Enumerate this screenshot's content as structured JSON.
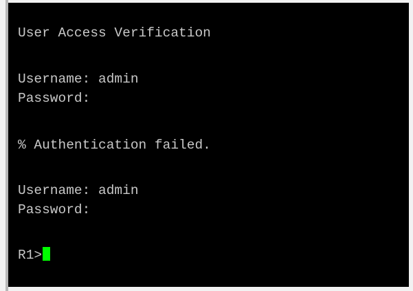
{
  "terminal": {
    "header": "User Access Verification",
    "attempts": [
      {
        "username": "Username: admin",
        "password": "Password:"
      }
    ],
    "error": "% Authentication failed.",
    "retry": {
      "username": "Username: admin",
      "password": "Password:"
    },
    "prompt": "R1>",
    "cursor_color": "#00ff00",
    "background_color": "#000000",
    "text_color": "#c8c8c8"
  }
}
